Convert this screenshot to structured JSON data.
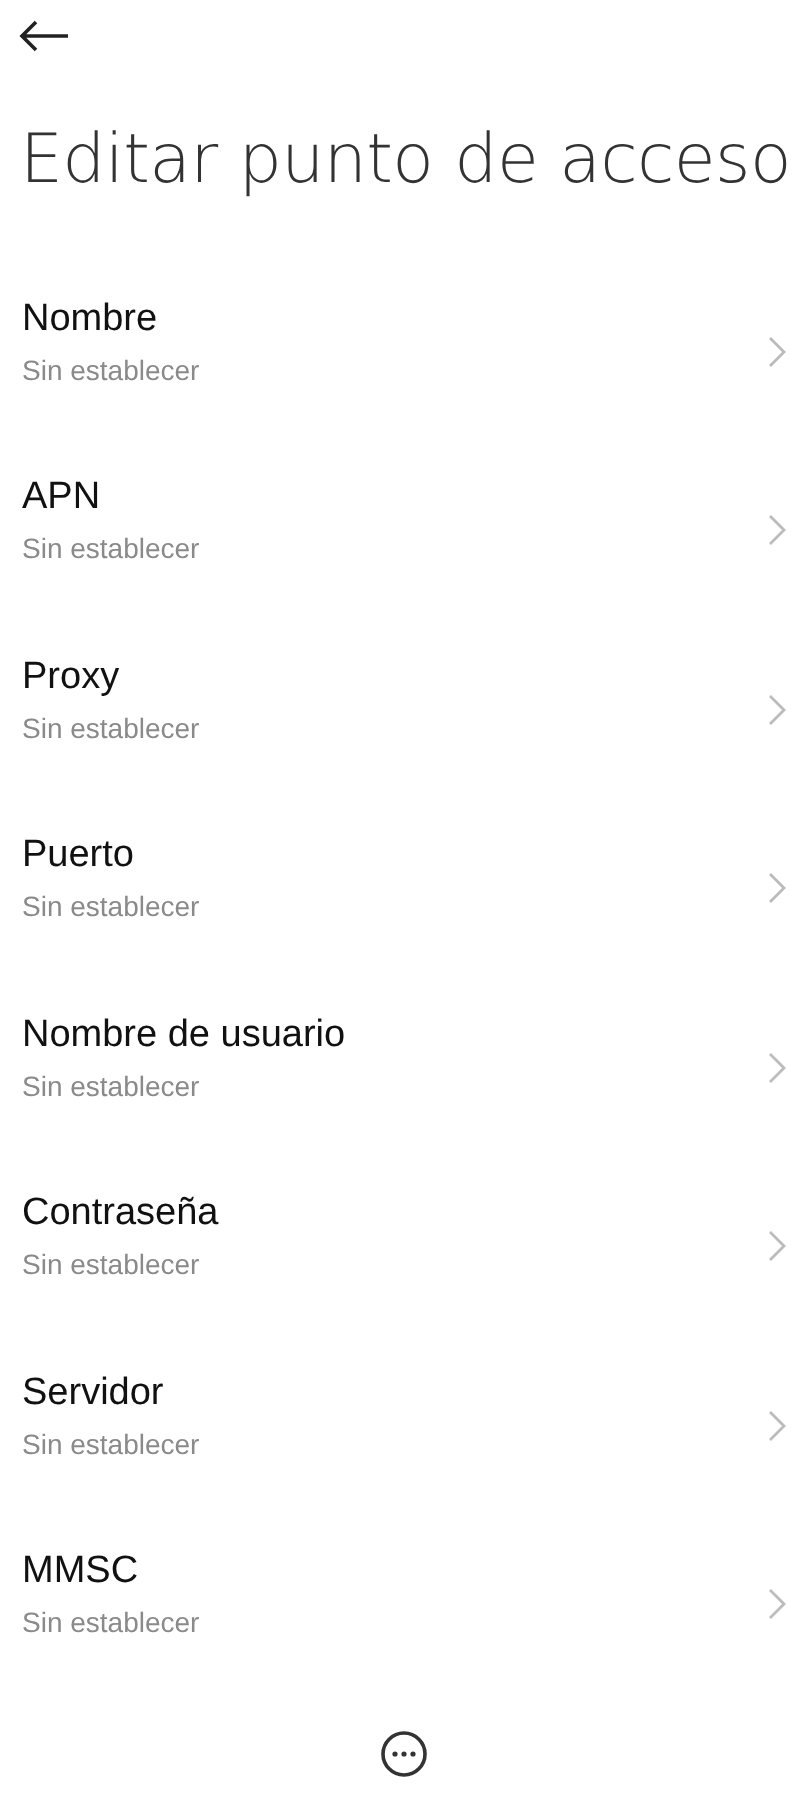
{
  "title": "Editar punto de acceso",
  "items": [
    {
      "label": "Nombre",
      "value": "Sin establecer"
    },
    {
      "label": "APN",
      "value": "Sin establecer"
    },
    {
      "label": "Proxy",
      "value": "Sin establecer"
    },
    {
      "label": "Puerto",
      "value": "Sin establecer"
    },
    {
      "label": "Nombre de usuario",
      "value": "Sin establecer"
    },
    {
      "label": "Contraseña",
      "value": "Sin establecer"
    },
    {
      "label": "Servidor",
      "value": "Sin establecer"
    },
    {
      "label": "MMSC",
      "value": "Sin establecer"
    }
  ]
}
